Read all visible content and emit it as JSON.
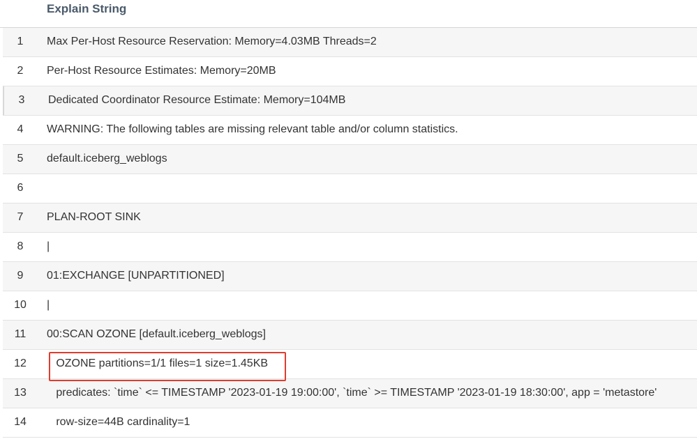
{
  "table": {
    "column_header": "Explain String",
    "rows": [
      {
        "num": "1",
        "text": "Max Per-Host Resource Reservation: Memory=4.03MB Threads=2"
      },
      {
        "num": "2",
        "text": "Per-Host Resource Estimates: Memory=20MB"
      },
      {
        "num": "3",
        "text": "Dedicated Coordinator Resource Estimate: Memory=104MB"
      },
      {
        "num": "4",
        "text": "WARNING: The following tables are missing relevant table and/or column statistics."
      },
      {
        "num": "5",
        "text": "default.iceberg_weblogs"
      },
      {
        "num": "6",
        "text": ""
      },
      {
        "num": "7",
        "text": "PLAN-ROOT SINK"
      },
      {
        "num": "8",
        "text": "|"
      },
      {
        "num": "9",
        "text": "01:EXCHANGE [UNPARTITIONED]"
      },
      {
        "num": "10",
        "text": "|"
      },
      {
        "num": "11",
        "text": "00:SCAN OZONE [default.iceberg_weblogs]"
      },
      {
        "num": "12",
        "text": "   OZONE partitions=1/1 files=1 size=1.45KB"
      },
      {
        "num": "13",
        "text": "   predicates: `time` <= TIMESTAMP '2023-01-19 19:00:00', `time` >= TIMESTAMP '2023-01-19 18:30:00', app = 'metastore'"
      },
      {
        "num": "14",
        "text": "   row-size=44B cardinality=1"
      }
    ]
  },
  "colors": {
    "highlight_border": "#e03c2e",
    "header_text": "#4a5a6a",
    "alt_row_bg": "#f6f6f6"
  }
}
